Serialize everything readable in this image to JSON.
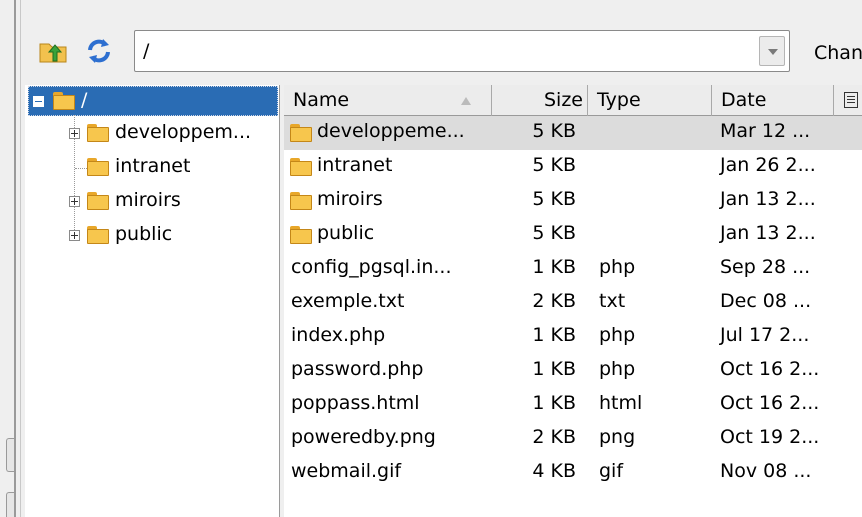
{
  "toolbar": {
    "path_value": "/",
    "change_label_prefix": "Chang",
    "change_label_accel": "e"
  },
  "tree": {
    "root_label": "/",
    "items": [
      {
        "label": "developpem...",
        "expandable": true
      },
      {
        "label": "intranet",
        "expandable": false
      },
      {
        "label": "miroirs",
        "expandable": true
      },
      {
        "label": "public",
        "expandable": true
      }
    ]
  },
  "list": {
    "columns": {
      "name": "Name",
      "size": "Size",
      "type": "Type",
      "date": "Date"
    },
    "rows": [
      {
        "name": "developpeme...",
        "size": "5 KB",
        "type": "",
        "date": "Mar 12 ...",
        "folder": true,
        "selected": true
      },
      {
        "name": "intranet",
        "size": "5 KB",
        "type": "",
        "date": "Jan 26 2...",
        "folder": true
      },
      {
        "name": "miroirs",
        "size": "5 KB",
        "type": "",
        "date": "Jan 13 2...",
        "folder": true
      },
      {
        "name": "public",
        "size": "5 KB",
        "type": "",
        "date": "Jan 13 2...",
        "folder": true
      },
      {
        "name": "config_pgsql.in...",
        "size": "1 KB",
        "type": "php",
        "date": "Sep 28 ...",
        "folder": false
      },
      {
        "name": "exemple.txt",
        "size": "2 KB",
        "type": "txt",
        "date": "Dec 08 ...",
        "folder": false
      },
      {
        "name": "index.php",
        "size": "1 KB",
        "type": "php",
        "date": "Jul 17 2...",
        "folder": false
      },
      {
        "name": "password.php",
        "size": "1 KB",
        "type": "php",
        "date": "Oct 16 2...",
        "folder": false
      },
      {
        "name": "poppass.html",
        "size": "1 KB",
        "type": "html",
        "date": "Oct 16 2...",
        "folder": false
      },
      {
        "name": "poweredby.png",
        "size": "2 KB",
        "type": "png",
        "date": "Oct 19 2...",
        "folder": false
      },
      {
        "name": "webmail.gif",
        "size": "4 KB",
        "type": "gif",
        "date": "Nov 08 ...",
        "folder": false
      }
    ]
  },
  "colors": {
    "selection": "#2a6cb4",
    "row_selected": "#dcdcdc",
    "folder": "#f7c64d"
  }
}
